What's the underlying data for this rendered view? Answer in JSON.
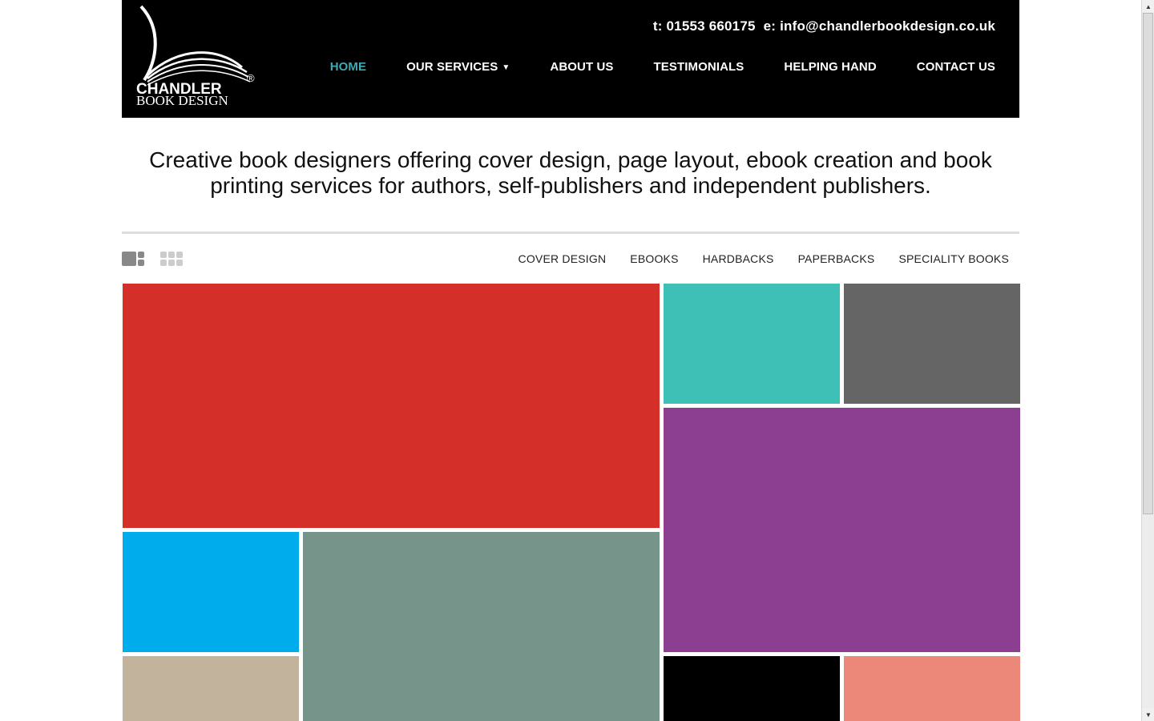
{
  "logo": {
    "brand": "CHANDLER",
    "sub": "BOOK DESIGN",
    "reg": "®"
  },
  "header": {
    "phone": "t: 01553 660175",
    "email": "e: info@chandlerbookdesign.co.uk"
  },
  "nav": {
    "home": "HOME",
    "services": "OUR SERVICES",
    "about": "ABOUT US",
    "testimonials": "TESTIMONIALS",
    "helping_hand": "HELPING HAND",
    "contact": "CONTACT US",
    "caret": "▼"
  },
  "tagline": "Creative book designers offering cover design, page layout, ebook creation and book printing services for authors, self-publishers and independent publishers.",
  "filters": {
    "cover_design": "COVER DESIGN",
    "ebooks": "EBOOKS",
    "hardbacks": "HARDBACKS",
    "paperbacks": "PAPERBACKS",
    "speciality_books": "SPECIALITY BOOKS"
  },
  "colors": {
    "nav_active": "#3fa9b3",
    "tile_red": "#d42f28",
    "tile_teal": "#3fc0b7",
    "tile_darkgrey": "#656565",
    "tile_purple": "#8c3f91",
    "tile_blue": "#00acec",
    "tile_sage": "#769489",
    "tile_beige": "#c1b39c",
    "tile_black": "#000000",
    "tile_salmon": "#ec8879"
  },
  "scrollbar": {
    "up_icon": "▲",
    "down_icon": "▼"
  }
}
